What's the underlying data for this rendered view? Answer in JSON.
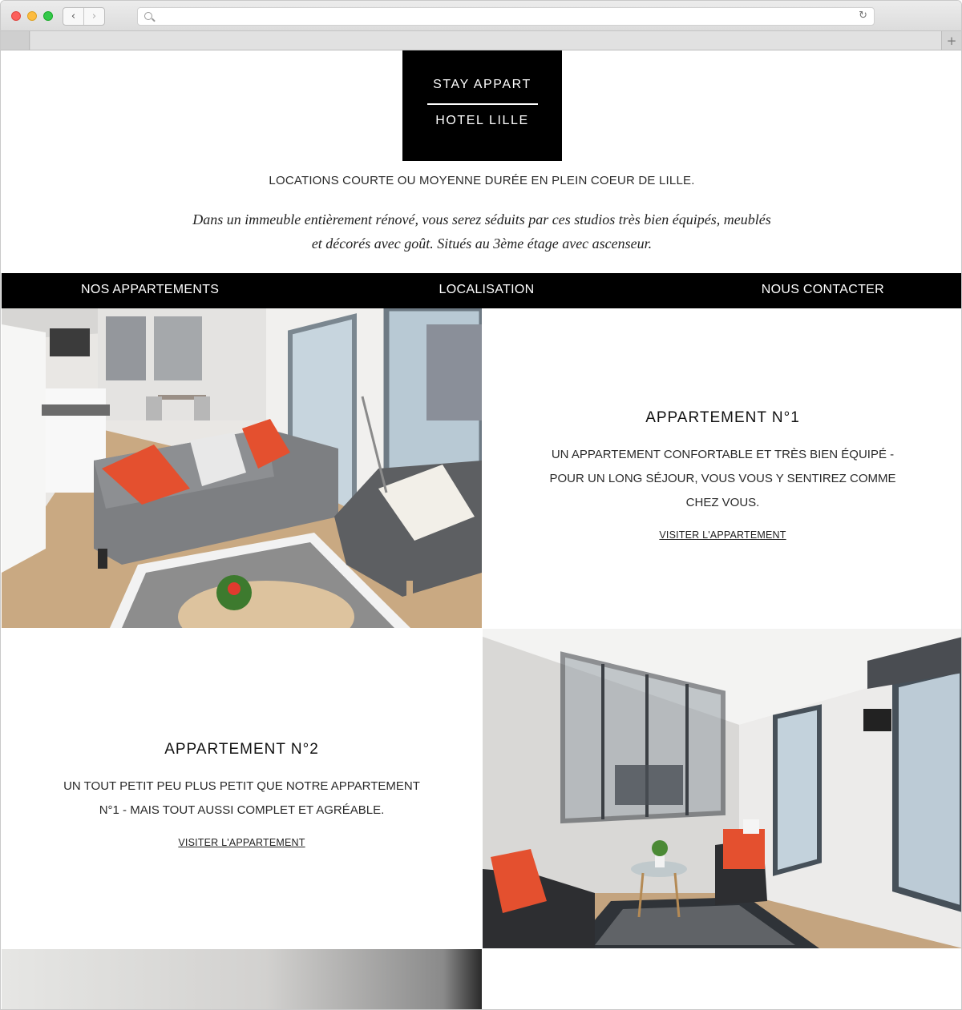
{
  "browser": {
    "back_glyph": "‹",
    "forward_glyph": "›",
    "reload_glyph": "↻",
    "new_tab_glyph": "+",
    "address_value": ""
  },
  "site": {
    "logo_line1": "STAY APPART",
    "logo_line2": "HOTEL LILLE",
    "tagline": "LOCATIONS COURTE OU MOYENNE DURÉE EN PLEIN COEUR DE LILLE.",
    "intro_line1": "Dans un immeuble entièrement rénové, vous serez séduits par ces studios très bien équipés, meublés",
    "intro_line2": "et décorés avec goût. Situés au 3ème étage avec ascenseur.",
    "nav": {
      "apartments": "NOS APPARTEMENTS",
      "location": "LOCALISATION",
      "contact": "NOUS CONTACTER"
    },
    "apartments": [
      {
        "title": "APPARTEMENT N°1",
        "desc_line1": "UN APPARTEMENT CONFORTABLE ET TRÈS BIEN ÉQUIPÉ -",
        "desc_line2": "POUR UN LONG SÉJOUR, VOUS VOUS Y SENTIREZ COMME",
        "desc_line3": "CHEZ VOUS.",
        "link": "VISITER L'APPARTEMENT"
      },
      {
        "title": "APPARTEMENT N°2",
        "desc_line1": "UN TOUT PETIT PEU PLUS PETIT QUE NOTRE APPARTEMENT",
        "desc_line2": "N°1 - MAIS TOUT AUSSI COMPLET ET AGRÉABLE.",
        "link": "VISITER L'APPARTEMENT"
      }
    ]
  },
  "colors": {
    "brand_black": "#000000",
    "page_bg": "#ffffff",
    "accent_cushion": "#e4502f",
    "sofa_grey": "#7d7f82"
  },
  "icons": [
    "search-icon",
    "reload-icon",
    "back-icon",
    "forward-icon",
    "new-tab-icon"
  ]
}
